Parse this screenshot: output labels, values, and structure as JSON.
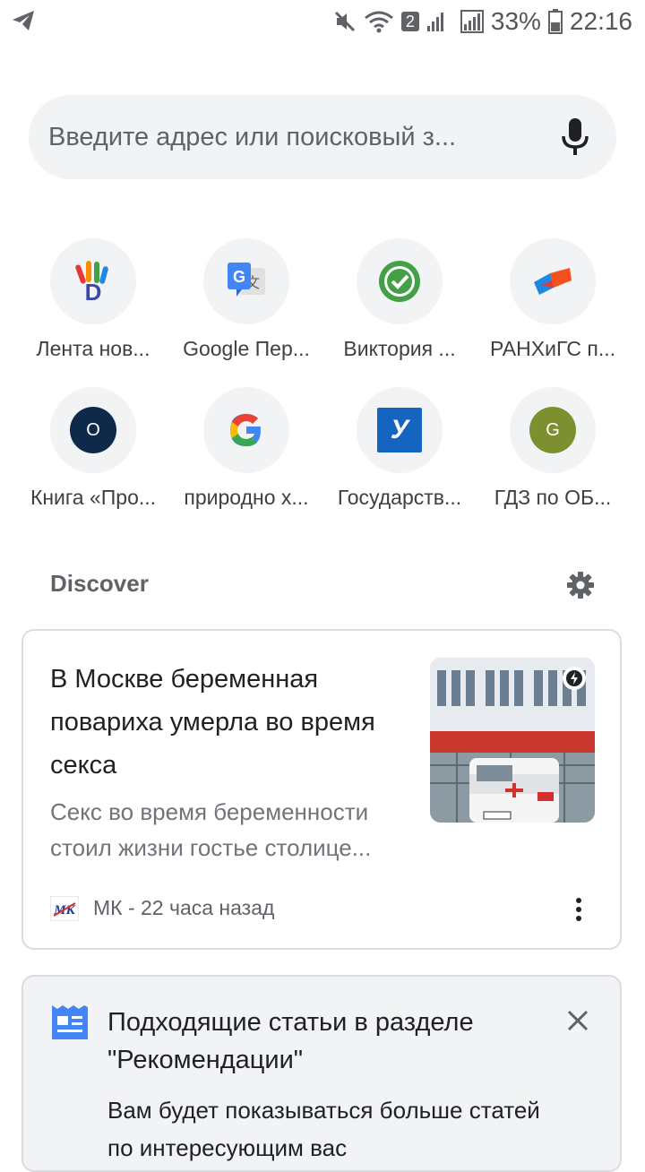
{
  "status_bar": {
    "battery": "33%",
    "time": "22:16",
    "sim_badge": "2"
  },
  "search": {
    "placeholder": "Введите адрес или поисковый з..."
  },
  "shortcuts": [
    {
      "label": "Лента нов...",
      "icon": "hand-logo-icon"
    },
    {
      "label": "Google Пер...",
      "icon": "google-translate-icon"
    },
    {
      "label": "Виктория ...",
      "icon": "green-check-icon"
    },
    {
      "label": "РАНХиГС п...",
      "icon": "ranepa-logo-icon"
    },
    {
      "label": "Книга «Про...",
      "icon": "letter-o-icon",
      "letter": "O"
    },
    {
      "label": "природно х...",
      "icon": "google-g-icon"
    },
    {
      "label": "Государств...",
      "icon": "gosuslugi-icon",
      "letter": "У"
    },
    {
      "label": "ГДЗ по ОБ...",
      "icon": "letter-g-icon",
      "letter": "G"
    }
  ],
  "discover": {
    "title": "Discover"
  },
  "article": {
    "title": "В Москве беременная повариха умерла во время секса",
    "snippet": "Секс во время беременности стоил жизни гостье столице...",
    "publisher_logo_text": "МК",
    "source": "МК - 22 часа назад"
  },
  "recommendation_card": {
    "title": "Подходящие статьи в разделе \"Рекомендации\"",
    "body": "Вам будет показываться больше статей по интересующим вас"
  },
  "colors": {
    "chip_bg": "#f1f3f4",
    "accent_blue": "#4285f4",
    "green": "#43a047",
    "olive": "#7d8f2e",
    "navy": "#0d2a4b"
  }
}
